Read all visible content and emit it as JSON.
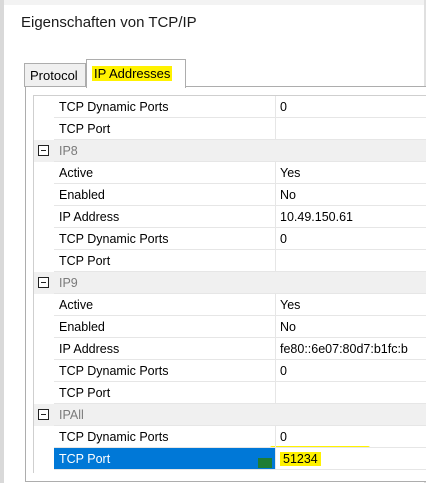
{
  "window": {
    "title": "Eigenschaften von TCP/IP"
  },
  "tabs": [
    {
      "label": "Protocol",
      "active": false
    },
    {
      "label": "IP Addresses",
      "active": true
    }
  ],
  "grid": {
    "rows": [
      {
        "type": "prop",
        "name": "TCP Dynamic Ports",
        "value": "0"
      },
      {
        "type": "prop",
        "name": "TCP Port",
        "value": ""
      },
      {
        "type": "category",
        "name": "IP8"
      },
      {
        "type": "prop",
        "name": "Active",
        "value": "Yes"
      },
      {
        "type": "prop",
        "name": "Enabled",
        "value": "No"
      },
      {
        "type": "prop",
        "name": "IP Address",
        "value": "10.49.150.61"
      },
      {
        "type": "prop",
        "name": "TCP Dynamic Ports",
        "value": "0"
      },
      {
        "type": "prop",
        "name": "TCP Port",
        "value": ""
      },
      {
        "type": "category",
        "name": "IP9"
      },
      {
        "type": "prop",
        "name": "Active",
        "value": "Yes"
      },
      {
        "type": "prop",
        "name": "Enabled",
        "value": "No"
      },
      {
        "type": "prop",
        "name": "IP Address",
        "value": "fe80::6e07:80d7:b1fc:b"
      },
      {
        "type": "prop",
        "name": "TCP Dynamic Ports",
        "value": "0"
      },
      {
        "type": "prop",
        "name": "TCP Port",
        "value": ""
      },
      {
        "type": "category",
        "name": "IPAll"
      },
      {
        "type": "prop",
        "name": "TCP Dynamic Ports",
        "value": "0"
      },
      {
        "type": "prop",
        "name": "TCP Port",
        "value": "51234",
        "selected": true
      }
    ]
  },
  "colors": {
    "selection": "#0078d7",
    "highlight": "#fff200",
    "category_text": "#7a7a7a",
    "marker": "#1e7d35"
  }
}
